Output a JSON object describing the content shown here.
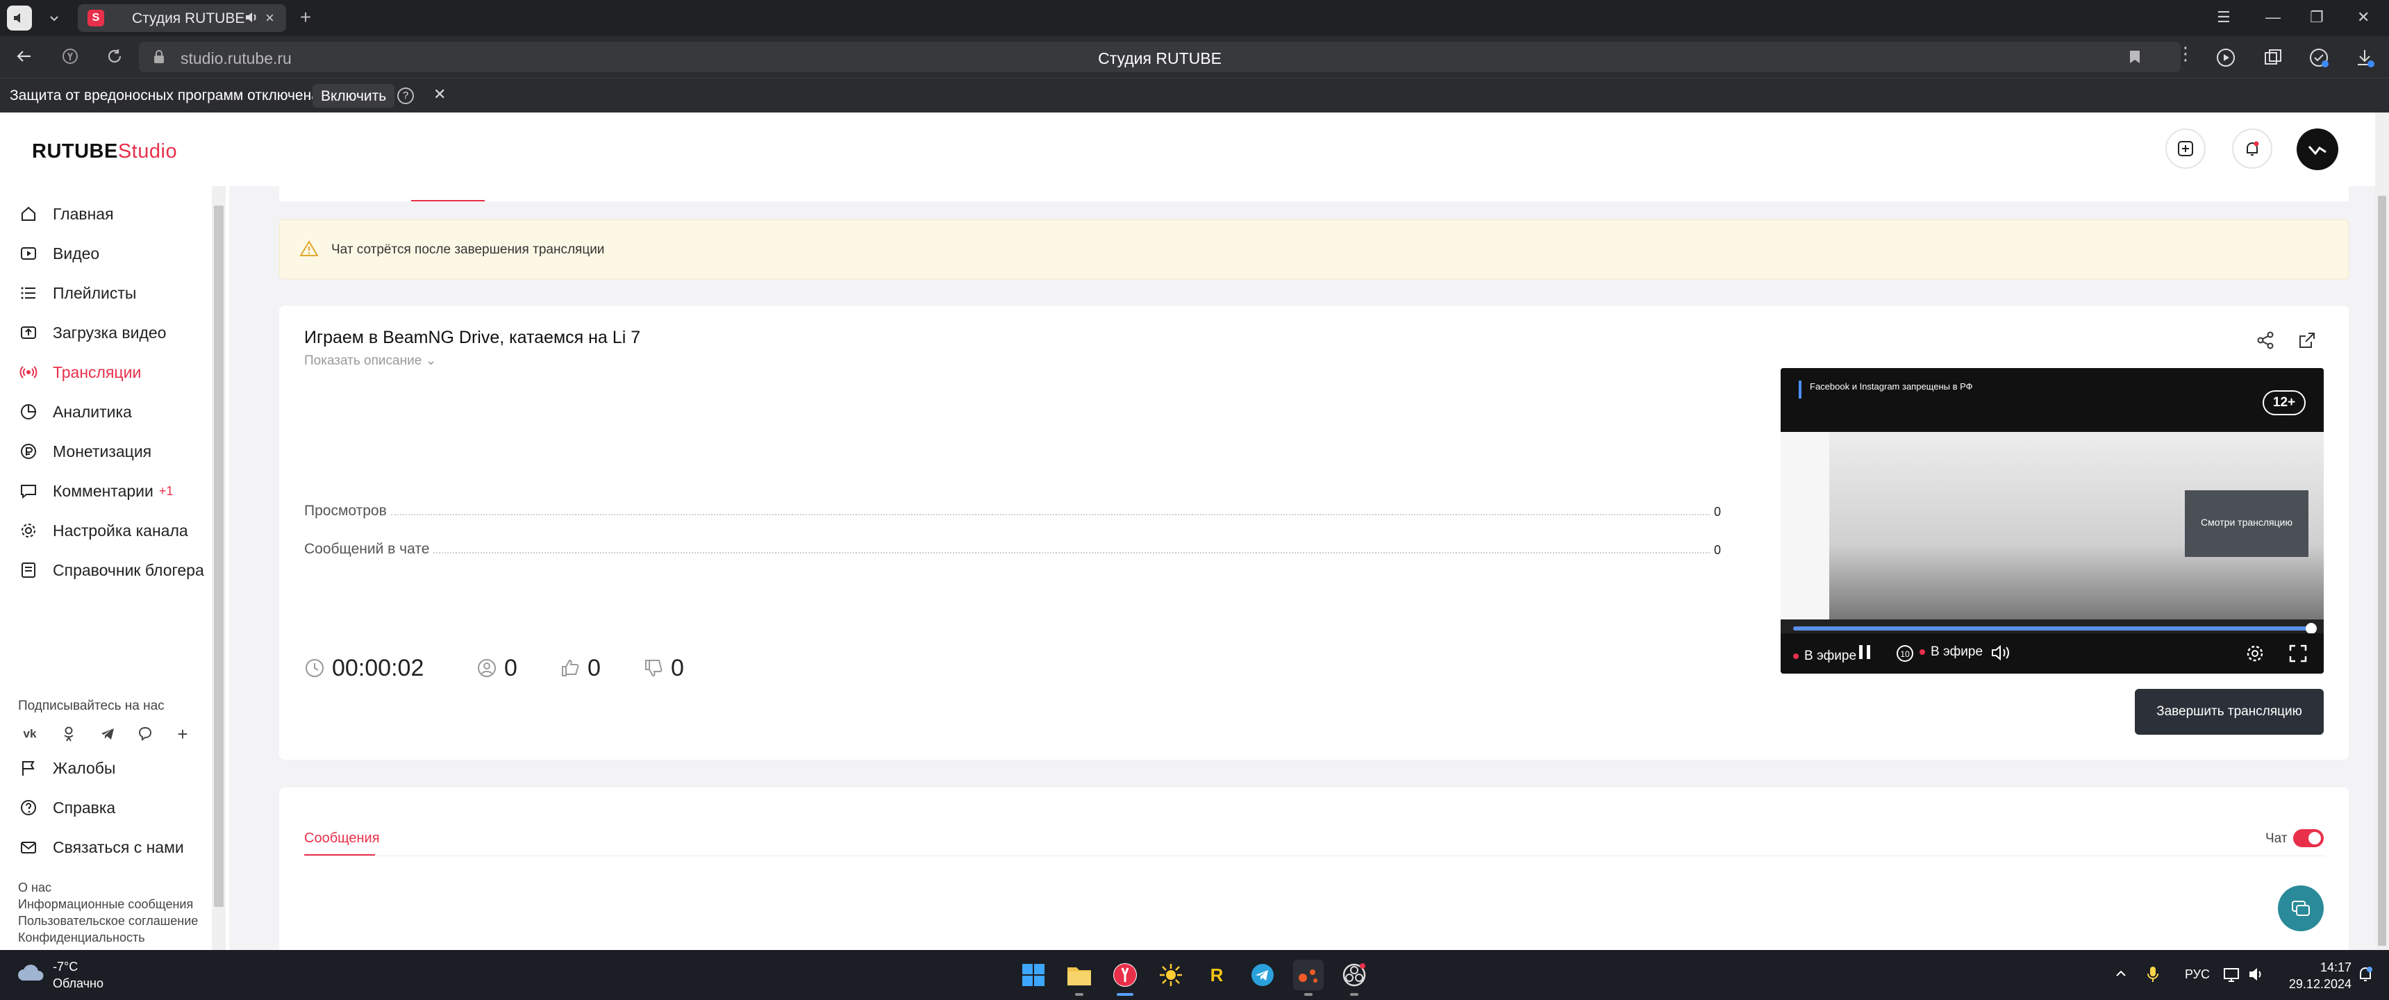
{
  "browser": {
    "tab_title": "Студия RUTUBE",
    "tab_favicon": "S",
    "url": "studio.rutube.ru",
    "page_title": "Студия RUTUBE",
    "notice_text": "Защита от вредоносных программ отключена",
    "notice_button": "Включить",
    "help_glyph": "?"
  },
  "header": {
    "logo_main": "RUTUBE",
    "logo_studio": "Studio"
  },
  "sidebar": {
    "items": [
      {
        "label": "Главная",
        "icon": "home-icon"
      },
      {
        "label": "Видео",
        "icon": "video-icon"
      },
      {
        "label": "Плейлисты",
        "icon": "playlist-icon"
      },
      {
        "label": "Загрузка видео",
        "icon": "upload-icon"
      },
      {
        "label": "Трансляции",
        "icon": "broadcast-icon",
        "active": true
      },
      {
        "label": "Аналитика",
        "icon": "analytics-icon"
      },
      {
        "label": "Монетизация",
        "icon": "monetization-icon"
      },
      {
        "label": "Комментарии",
        "icon": "comments-icon",
        "badge": "+1"
      },
      {
        "label": "Настройка канала",
        "icon": "settings-icon"
      },
      {
        "label": "Справочник блогера",
        "icon": "book-icon"
      }
    ],
    "subscribe_label": "Подписывайтесь на нас",
    "social": [
      "vk",
      "ok",
      "telegram",
      "viber",
      "+"
    ],
    "bottom_items": [
      {
        "label": "Жалобы",
        "icon": "flag-icon"
      },
      {
        "label": "Справка",
        "icon": "help-icon"
      },
      {
        "label": "Связаться с нами",
        "icon": "mail-icon"
      }
    ],
    "footer_links": [
      "О нас",
      "Информационные сообщения",
      "Пользовательское соглашение",
      "Конфиденциальность"
    ]
  },
  "warning": {
    "text": "Чат сотрётся после завершения трансляции"
  },
  "stream": {
    "title": "Играем в BeamNG Drive, катаемся на Li 7",
    "show_description": "Показать описание",
    "stats": [
      {
        "label": "Просмотров",
        "value": "0"
      },
      {
        "label": "Сообщений в чате",
        "value": "0"
      }
    ],
    "timer": "00:00:02",
    "viewers": "0",
    "likes": "0",
    "dislikes": "0",
    "end_button": "Завершить трансляцию"
  },
  "player": {
    "banner_text": "Facebook и Instagram запрещены в РФ",
    "age_rating": "12+",
    "promo_text": "Смотри трансляцию",
    "live_label": "В эфире",
    "live_label_left": "В эфире",
    "rewind_label": "10"
  },
  "messages": {
    "tab_label": "Сообщения",
    "chat_label": "Чат",
    "chat_enabled": true
  },
  "taskbar": {
    "temperature": "-7°C",
    "weather": "Облачно",
    "language": "РУС",
    "time": "14:17",
    "date": "29.12.2024"
  },
  "colors": {
    "accent": "#e8304b",
    "warning_bg": "#fdf8e6",
    "end_button_bg": "#2c3038",
    "help_fab": "#2a8a99"
  }
}
